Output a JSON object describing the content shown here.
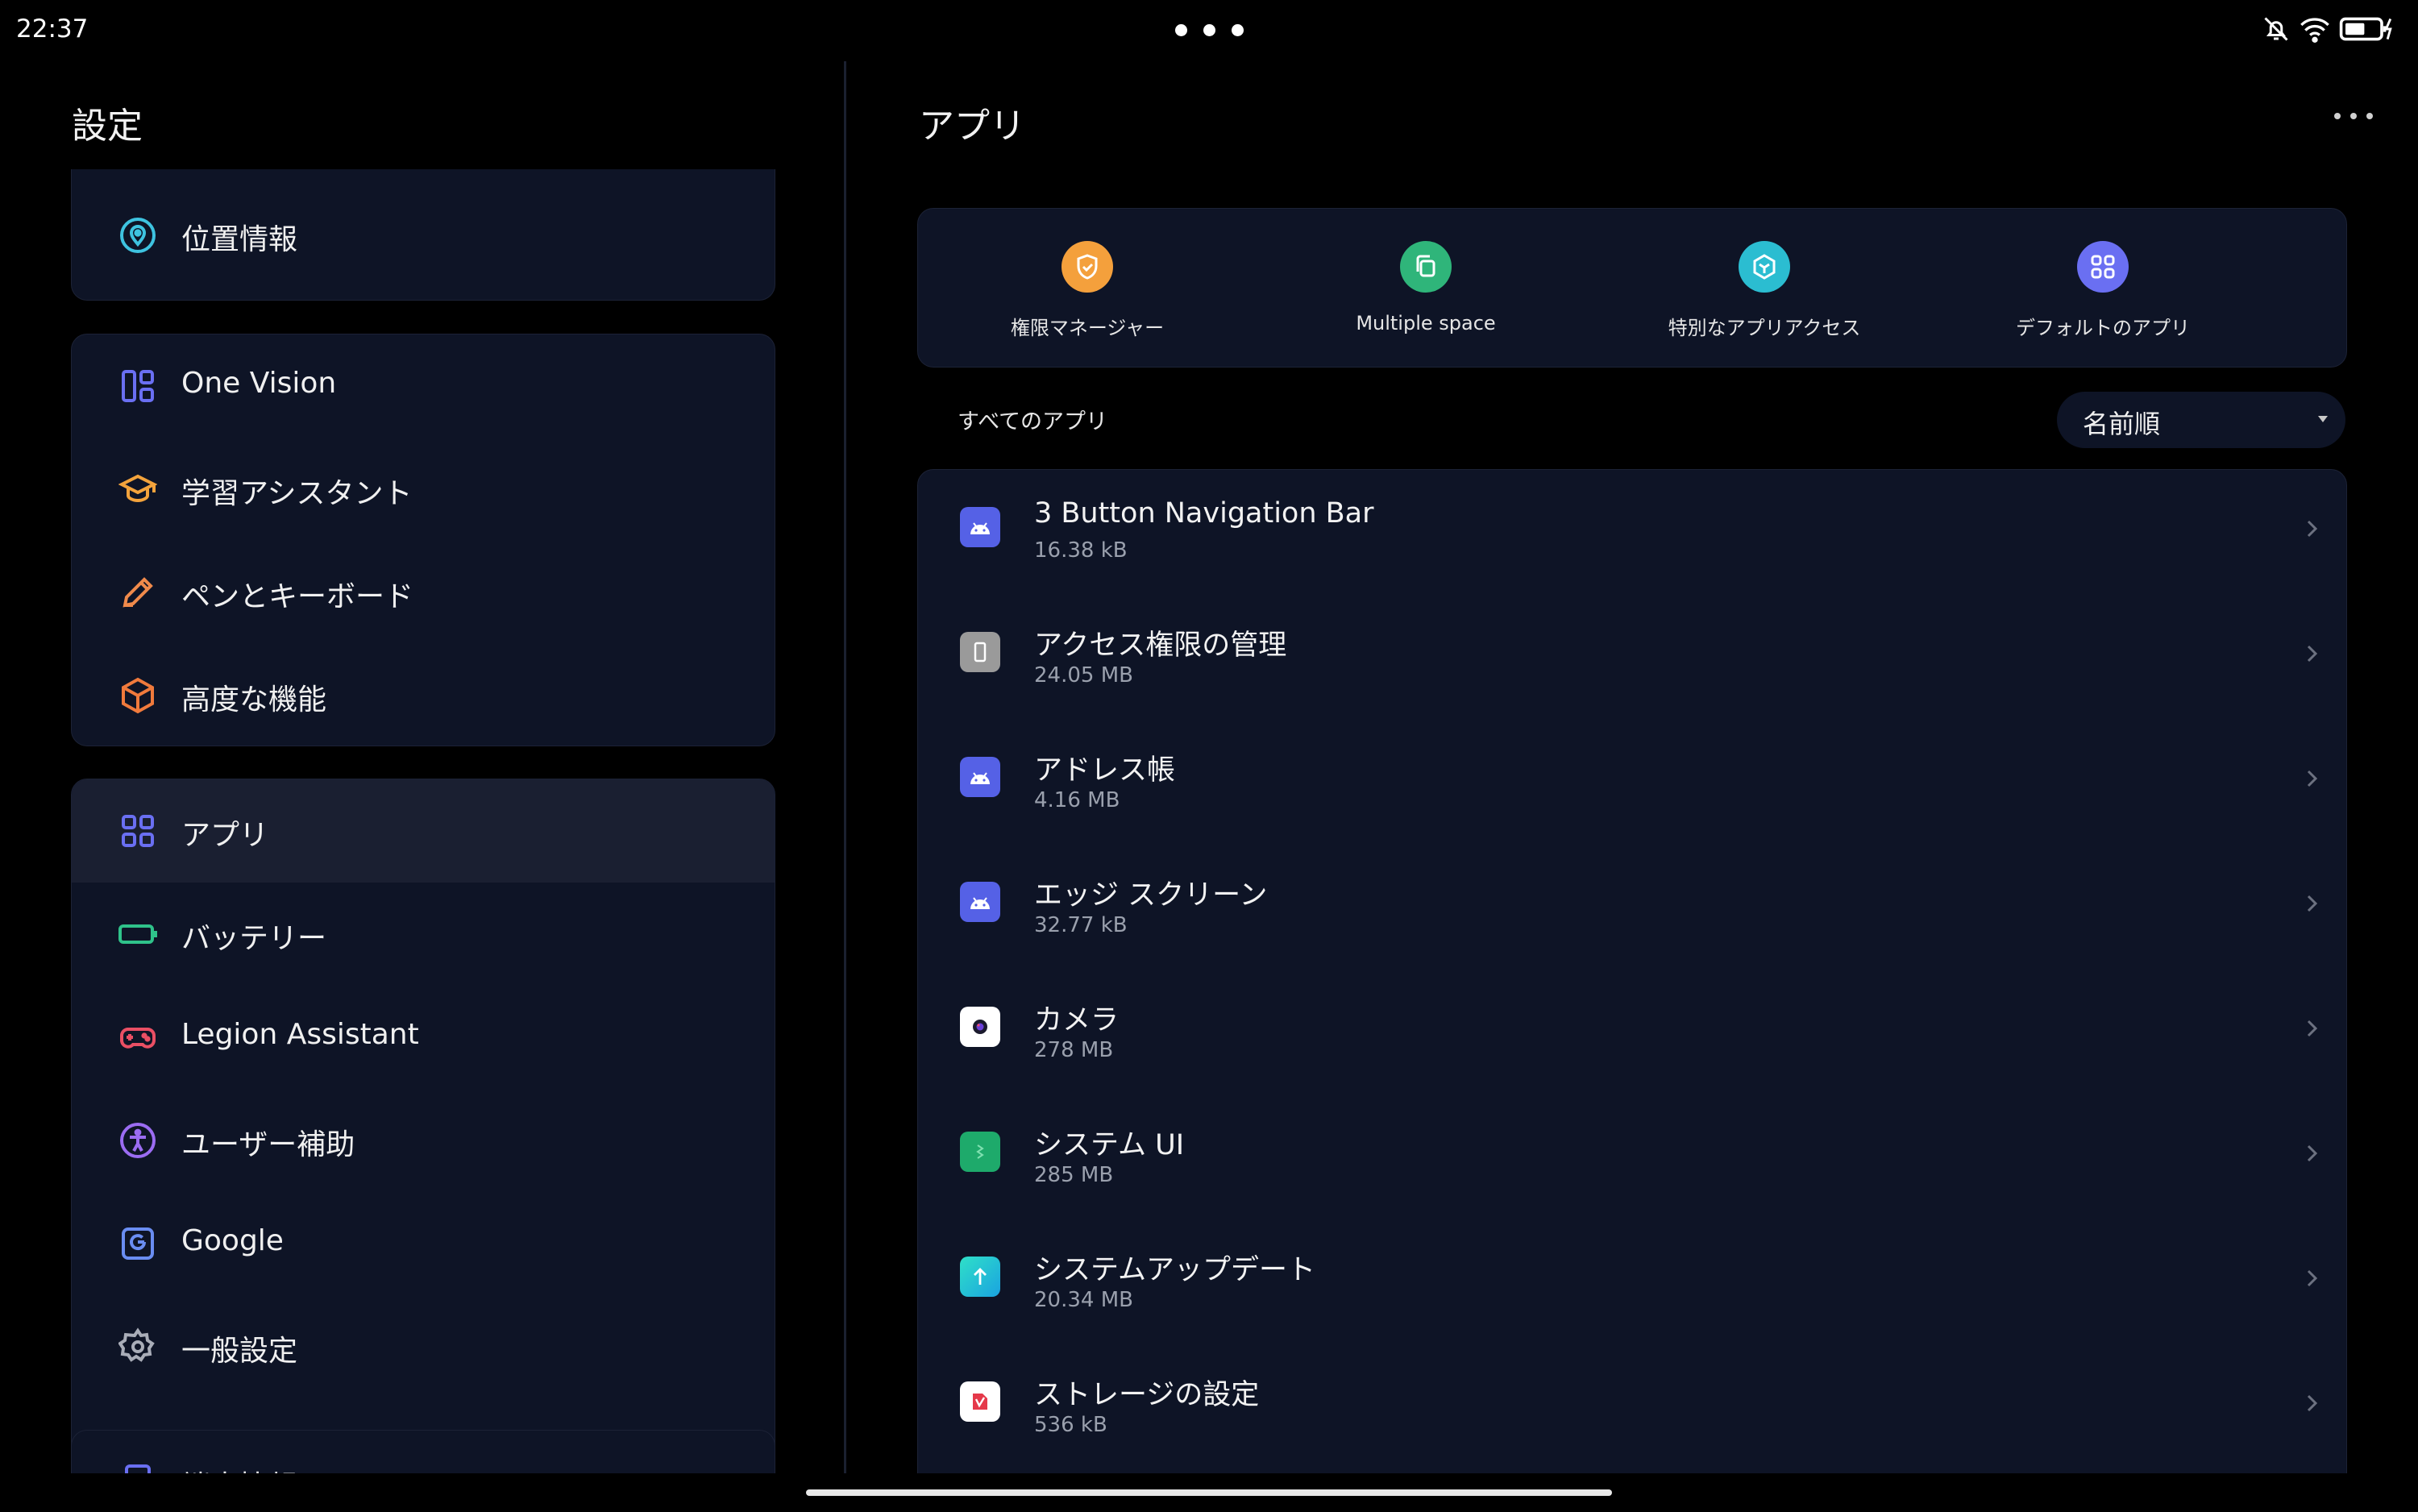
{
  "status_bar": {
    "time": "22:37"
  },
  "left": {
    "title": "設定",
    "groups": [
      {
        "items": [
          {
            "label": "位置情報",
            "icon": "location-pin-icon"
          }
        ]
      },
      {
        "items": [
          {
            "label": "One Vision",
            "icon": "one-vision-icon"
          },
          {
            "label": "学習アシスタント",
            "icon": "graduation-cap-icon"
          },
          {
            "label": "ペンとキーボード",
            "icon": "pen-icon"
          },
          {
            "label": "高度な機能",
            "icon": "cube-icon"
          }
        ]
      },
      {
        "items": [
          {
            "label": "アプリ",
            "icon": "apps-grid-icon",
            "active": true
          },
          {
            "label": "バッテリー",
            "icon": "battery-icon"
          },
          {
            "label": "Legion Assistant",
            "icon": "gamepad-icon"
          },
          {
            "label": "ユーザー補助",
            "icon": "accessibility-icon"
          },
          {
            "label": "Google",
            "icon": "google-icon"
          },
          {
            "label": "一般設定",
            "icon": "gear-icon"
          }
        ]
      },
      {
        "items": [
          {
            "label": "端末情報",
            "icon": "device-info-icon"
          }
        ]
      }
    ]
  },
  "right": {
    "title": "アプリ",
    "shortcuts": [
      {
        "label": "権限マネージャー",
        "icon": "shield-check-icon",
        "color": "#f4a03c"
      },
      {
        "label": "Multiple space",
        "icon": "copy-icon",
        "color": "#2fb57a"
      },
      {
        "label": "特別なアプリアクセス",
        "icon": "hexagon-icon",
        "color": "#2bbdd1"
      },
      {
        "label": "デフォルトのアプリ",
        "icon": "apps-grid-icon",
        "color": "#6a6ff2"
      }
    ],
    "all_apps_label": "すべてのアプリ",
    "sort": {
      "value": "名前順"
    },
    "apps": [
      {
        "name": "3 Button Navigation Bar",
        "size": "16.38 kB",
        "icon": "android-icon"
      },
      {
        "name": "アクセス権限の管理",
        "size": "24.05 MB",
        "icon": "permission-icon"
      },
      {
        "name": "アドレス帳",
        "size": "4.16 MB",
        "icon": "android-icon"
      },
      {
        "name": "エッジ スクリーン",
        "size": "32.77 kB",
        "icon": "android-icon"
      },
      {
        "name": "カメラ",
        "size": "278 MB",
        "icon": "camera-icon"
      },
      {
        "name": "システム UI",
        "size": "285 MB",
        "icon": "system-ui-icon"
      },
      {
        "name": "システムアップデート",
        "size": "20.34 MB",
        "icon": "system-update-icon"
      },
      {
        "name": "ストレージの設定",
        "size": "536 kB",
        "icon": "storage-icon"
      }
    ]
  },
  "colors": {
    "background": "#000000",
    "card": "#0e1426",
    "active_row": "#1a1f31",
    "accent_blue": "#6a6ff2"
  }
}
